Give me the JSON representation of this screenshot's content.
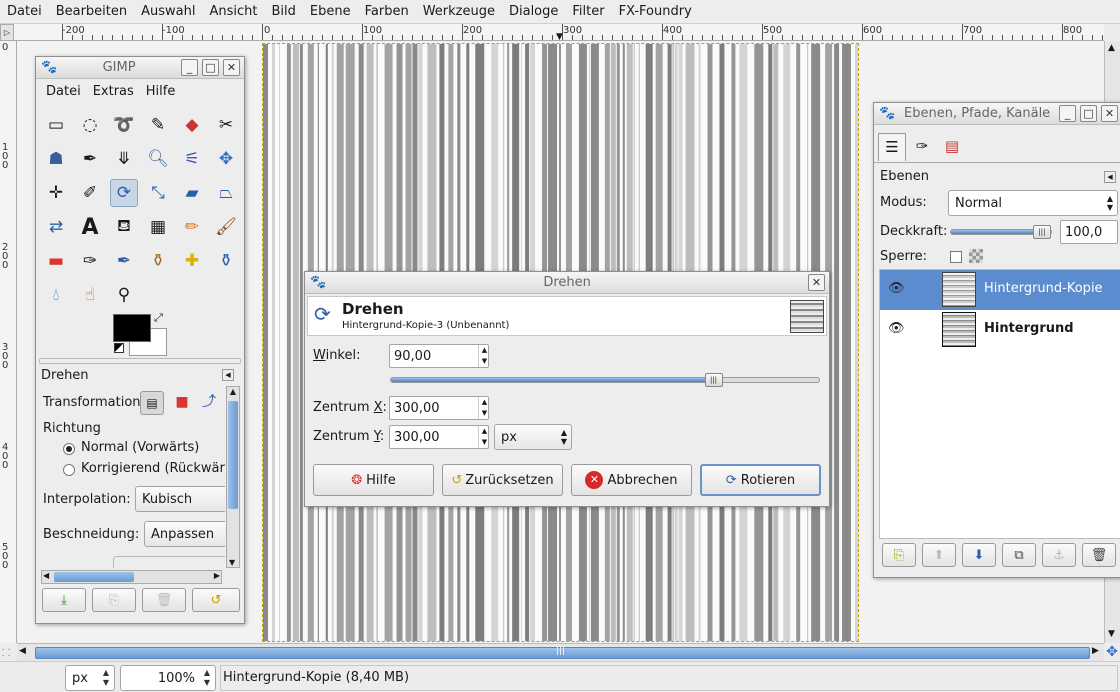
{
  "menubar": {
    "items": [
      "Datei",
      "Bearbeiten",
      "Auswahl",
      "Ansicht",
      "Bild",
      "Ebene",
      "Farben",
      "Werkzeuge",
      "Dialoge",
      "Filter",
      "FX-Foundry"
    ]
  },
  "ruler": {
    "h_labels": [
      "-200",
      "-100",
      "0",
      "100",
      "200",
      "300",
      "400",
      "500",
      "600",
      "700",
      "800"
    ],
    "v_labels": [
      "0",
      "100",
      "200",
      "300",
      "400",
      "500"
    ]
  },
  "toolbox": {
    "title": "GIMP",
    "menu": [
      "Datei",
      "Extras",
      "Hilfe"
    ],
    "tool_options_title": "Drehen",
    "transformation_label": "Transformation:",
    "direction_label": "Richtung",
    "direction_options": [
      "Normal (Vorwärts)",
      "Korrigierend (Rückwärt"
    ],
    "interpolation_label": "Interpolation:",
    "interpolation_value": "Kubisch",
    "clipping_label": "Beschneidung:",
    "clipping_value": "Anpassen"
  },
  "rotate_dialog": {
    "window_title": "Drehen",
    "heading": "Drehen",
    "subheading": "Hintergrund-Kopie-3 (Unbenannt)",
    "angle_label": "Winkel:",
    "angle_value": "90,00",
    "angle_slider_fraction": 0.75,
    "center_x_label": "Zentrum X:",
    "center_x_value": "300,00",
    "center_y_label": "Zentrum Y:",
    "center_y_value": "300,00",
    "unit_value": "px",
    "buttons": {
      "help": "Hilfe",
      "reset": "Zurücksetzen",
      "cancel": "Abbrechen",
      "rotate": "Rotieren"
    }
  },
  "layers_dialog": {
    "title": "Ebenen, Pfade, Kanäle",
    "section_title": "Ebenen",
    "mode_label": "Modus:",
    "mode_value": "Normal",
    "opacity_label": "Deckkraft:",
    "opacity_value": "100,0",
    "lock_label": "Sperre:",
    "layers": [
      {
        "name": "Hintergrund-Kopie",
        "selected": true
      },
      {
        "name": "Hintergrund",
        "selected": false
      }
    ]
  },
  "statusbar": {
    "unit": "px",
    "zoom": "100%",
    "message": "Hintergrund-Kopie (8,40 MB)"
  },
  "colors": {
    "selection": "#5b8ccf",
    "accent": "#4a7fc1"
  }
}
